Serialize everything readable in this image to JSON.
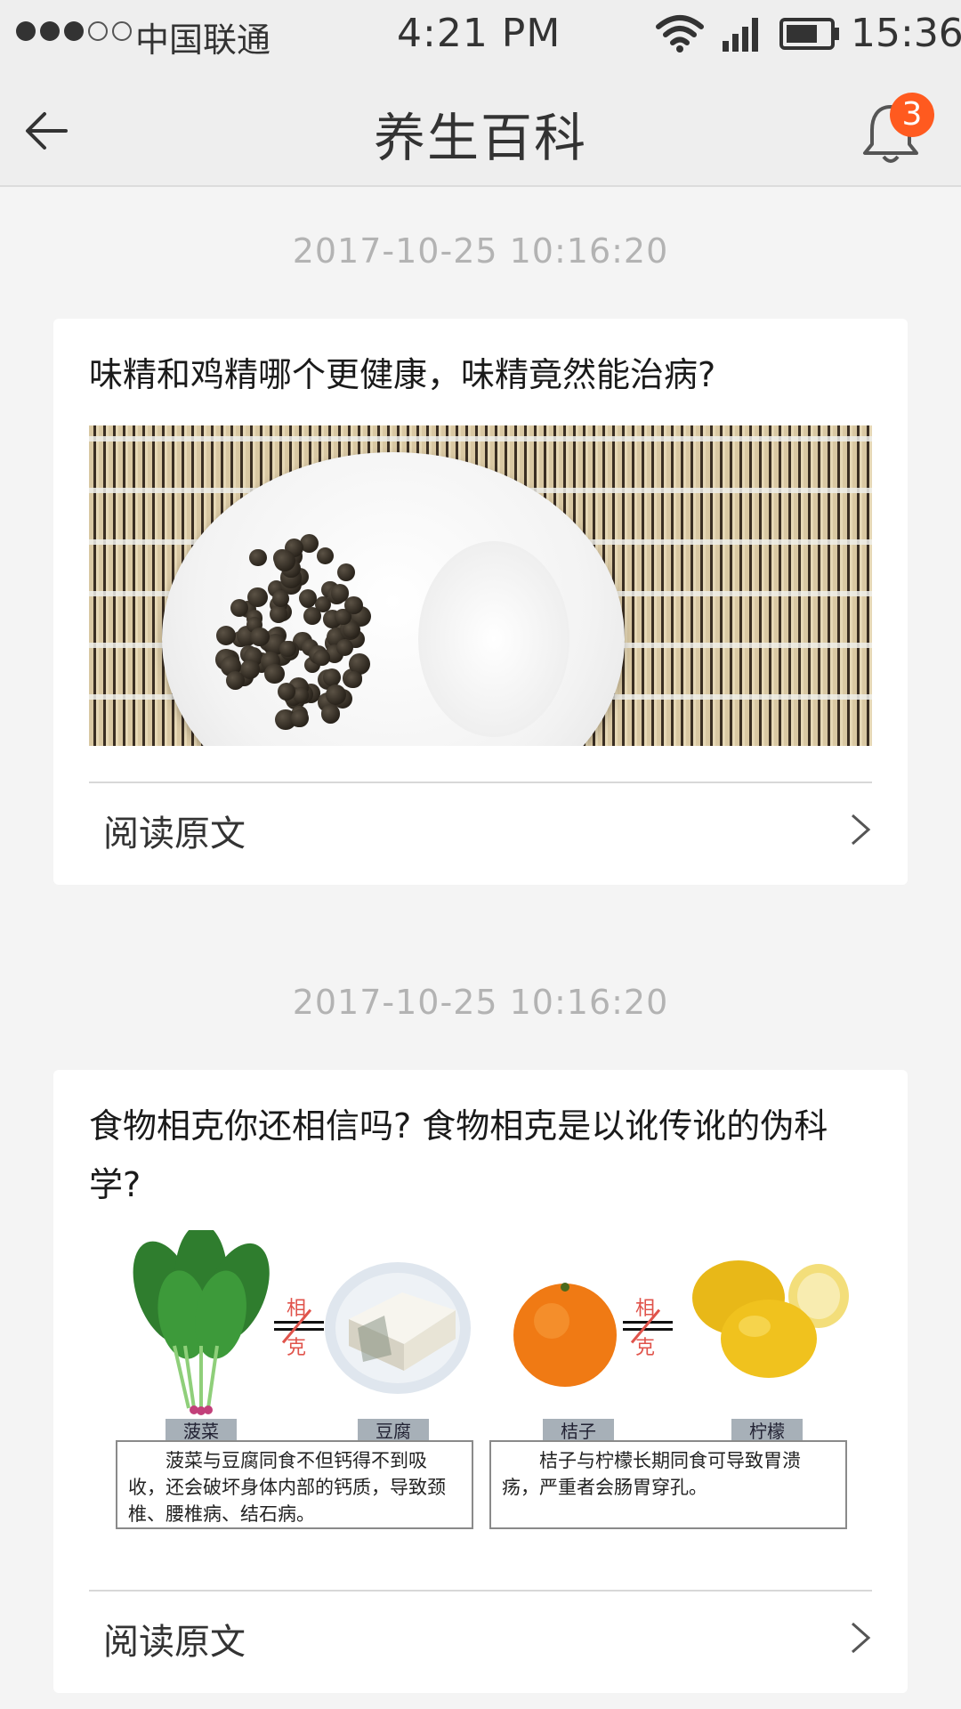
{
  "status_bar": {
    "carrier": "中国联通",
    "time_center": "4:21 PM",
    "time_right": "15:36",
    "icons": [
      "signal-dots-icon",
      "wifi-icon",
      "cell-signal-icon",
      "battery-icon"
    ]
  },
  "nav": {
    "title": "养生百科",
    "back_icon": "back-arrow-icon",
    "bell_icon": "bell-icon",
    "badge_count": "3"
  },
  "colors": {
    "background": "#f4f4f4",
    "nav_background": "#eeeeee",
    "badge": "#ff5a1f",
    "timestamp": "#b3b3b3"
  },
  "articles": [
    {
      "timestamp": "2017-10-25  10:16:20",
      "title": "味精和鸡精哪个更健康，味精竟然能治病?",
      "image": "pepper-and-salt-plate",
      "read_more": "阅读原文"
    },
    {
      "timestamp": "2017-10-25  10:16:20",
      "title": "食物相克你还相信吗? 食物相克是以讹传讹的伪科学?",
      "image": "food-incompatibility-chart",
      "image_text": {
        "xiangke_top": "相",
        "xiangke_bottom": "克",
        "labels": [
          "菠菜",
          "豆腐",
          "桔子",
          "柠檬"
        ],
        "note_left": "菠菜与豆腐同食不但钙得不到吸收，还会破坏身体内部的钙质，导致颈椎、腰椎病、结石病。",
        "note_right": "桔子与柠檬长期同食可导致胃溃疡，严重者会肠胃穿孔。"
      },
      "read_more": "阅读原文"
    }
  ]
}
